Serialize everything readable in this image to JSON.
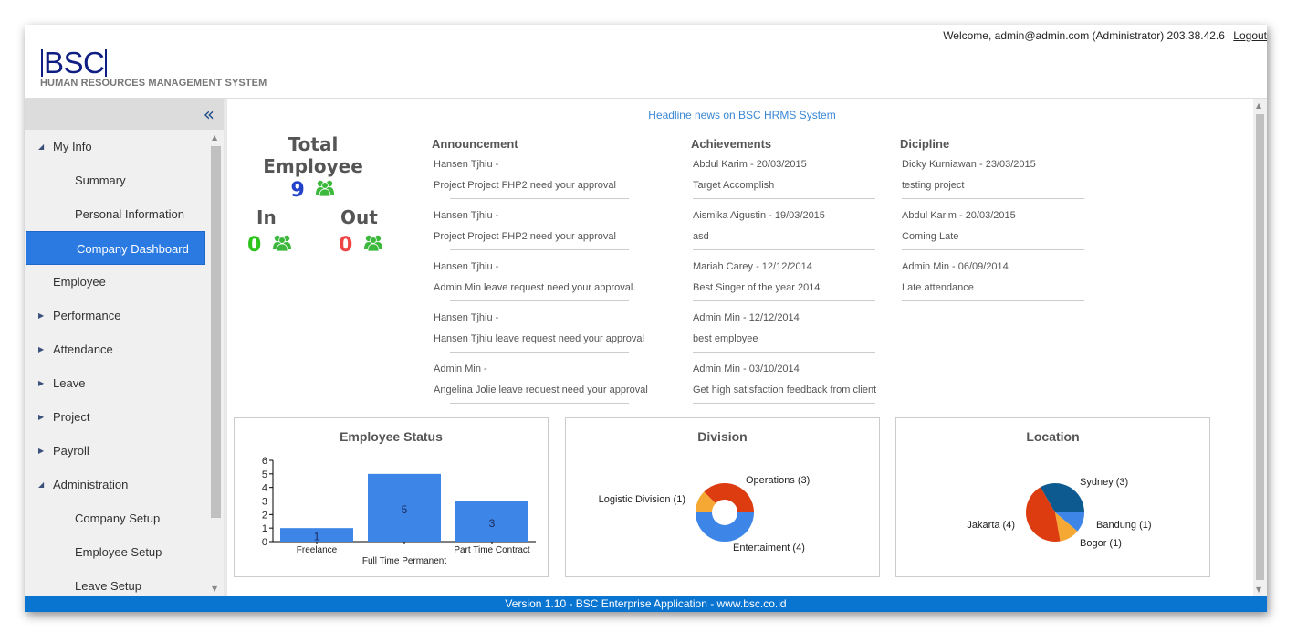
{
  "header": {
    "logo_text": "BSC",
    "subtitle": "HUMAN RESOURCES MANAGEMENT SYSTEM",
    "welcome_text": "Welcome, admin@admin.com (Administrator) 203.38.42.6",
    "logout_label": "Logout"
  },
  "sidebar": {
    "collapse_icon": "double-chevron-left-icon",
    "items": [
      {
        "label": "My Info",
        "level": 0,
        "arrow": "expanded"
      },
      {
        "label": "Summary",
        "level": 1
      },
      {
        "label": "Personal Information",
        "level": 1
      },
      {
        "label": "Company Dashboard",
        "level": 1,
        "active": true
      },
      {
        "label": "Employee",
        "level": 0
      },
      {
        "label": "Performance",
        "level": 0,
        "arrow": "collapsed"
      },
      {
        "label": "Attendance",
        "level": 0,
        "arrow": "collapsed"
      },
      {
        "label": "Leave",
        "level": 0,
        "arrow": "collapsed"
      },
      {
        "label": "Project",
        "level": 0,
        "arrow": "collapsed"
      },
      {
        "label": "Payroll",
        "level": 0,
        "arrow": "collapsed"
      },
      {
        "label": "Administration",
        "level": 0,
        "arrow": "expanded"
      },
      {
        "label": "Company Setup",
        "level": 1
      },
      {
        "label": "Employee Setup",
        "level": 1
      },
      {
        "label": "Leave Setup",
        "level": 1
      }
    ]
  },
  "main": {
    "headline": "Headline news on BSC HRMS System",
    "stats": {
      "total_label": "Total Employee",
      "total_value": "9",
      "in_label": "In",
      "in_value": "0",
      "out_label": "Out",
      "out_value": "0",
      "colors": {
        "total": "#2442c9",
        "in": "#2ec41e",
        "out": "#ee4444",
        "icon": "#3cb83c"
      }
    },
    "announcement": {
      "title": "Announcement",
      "items": [
        {
          "line1": "Hansen Tjhiu -",
          "line2": "Project Project FHP2 need your approval"
        },
        {
          "line1": "Hansen Tjhiu -",
          "line2": "Project Project FHP2 need your approval"
        },
        {
          "line1": "Hansen Tjhiu -",
          "line2": "Admin Min leave request need your approval."
        },
        {
          "line1": "Hansen Tjhiu -",
          "line2": "Hansen Tjhiu leave request need your approval"
        },
        {
          "line1": "Admin Min -",
          "line2": "Angelina Jolie leave request need your approval"
        }
      ]
    },
    "achievements": {
      "title": "Achievements",
      "items": [
        {
          "line1": "Abdul Karim - 20/03/2015",
          "line2": "Target Accomplish"
        },
        {
          "line1": "Aismika Aigustin - 19/03/2015",
          "line2": "asd"
        },
        {
          "line1": "Mariah Carey - 12/12/2014",
          "line2": "Best Singer of the year 2014"
        },
        {
          "line1": "Admin Min - 12/12/2014",
          "line2": "best employee"
        },
        {
          "line1": "Admin Min - 03/10/2014",
          "line2": "Get high satisfaction feedback from client"
        }
      ]
    },
    "dicipline": {
      "title": "Dicipline",
      "items": [
        {
          "line1": "Dicky Kurniawan - 23/03/2015",
          "line2": "testing project"
        },
        {
          "line1": "Abdul Karim - 20/03/2015",
          "line2": "Coming Late"
        },
        {
          "line1": "Admin Min - 06/09/2014",
          "line2": "Late attendance"
        }
      ]
    }
  },
  "chart_data": [
    {
      "type": "bar",
      "title": "Employee Status",
      "categories": [
        "Freelance",
        "Full Time Permanent",
        "Part Time Contract"
      ],
      "values": [
        1,
        5,
        3
      ],
      "ylim": [
        0,
        6
      ],
      "yticks": [
        0,
        1,
        2,
        3,
        4,
        5,
        6
      ],
      "xlabel": "",
      "ylabel": "",
      "color": "#3d86e8",
      "grid": false
    },
    {
      "type": "pie",
      "donut": true,
      "title": "Division",
      "slices": [
        {
          "label": "Entertaiment",
          "value": 4,
          "color": "#3d86e8"
        },
        {
          "label": "Logistic Division",
          "value": 1,
          "color": "#f5a833"
        },
        {
          "label": "Operations",
          "value": 3,
          "color": "#dc3c0f"
        }
      ]
    },
    {
      "type": "pie",
      "donut": false,
      "title": "Location",
      "slices": [
        {
          "label": "Bandung",
          "value": 1,
          "color": "#3d86e8"
        },
        {
          "label": "Bogor",
          "value": 1,
          "color": "#f5a833"
        },
        {
          "label": "Jakarta",
          "value": 4,
          "color": "#dc3c0f"
        },
        {
          "label": "Sydney",
          "value": 3,
          "color": "#0c5a8f"
        }
      ]
    }
  ],
  "footer": {
    "text": "Version 1.10 - BSC Enterprise Application - www.bsc.co.id"
  }
}
